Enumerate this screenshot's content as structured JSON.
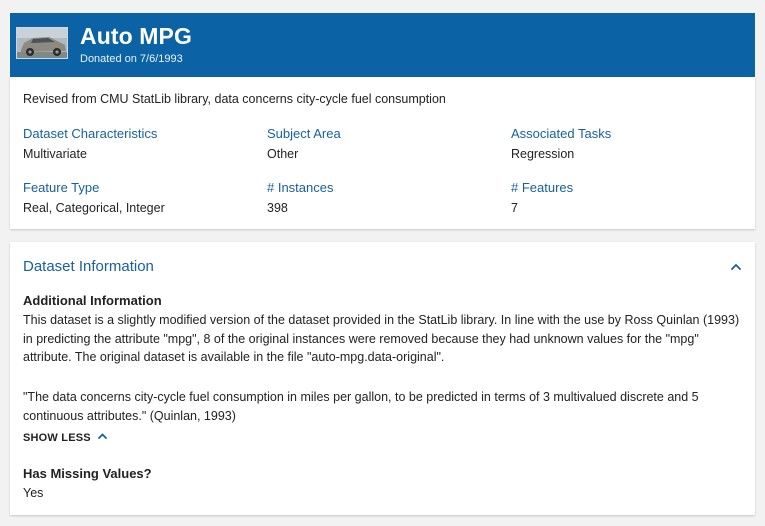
{
  "header": {
    "title": "Auto MPG",
    "donated": "Donated on 7/6/1993",
    "thumbnail_icon": "car-photo-icon"
  },
  "summary": {
    "description": "Revised from CMU StatLib library, data concerns city-cycle fuel consumption",
    "attributes": [
      {
        "label": "Dataset Characteristics",
        "value": "Multivariate"
      },
      {
        "label": "Subject Area",
        "value": "Other"
      },
      {
        "label": "Associated Tasks",
        "value": "Regression"
      },
      {
        "label": "Feature Type",
        "value": "Real, Categorical, Integer"
      },
      {
        "label": "# Instances",
        "value": "398"
      },
      {
        "label": "# Features",
        "value": "7"
      }
    ]
  },
  "info": {
    "title": "Dataset Information",
    "collapse_icon": "chevron-up-icon",
    "additional_heading": "Additional Information",
    "paragraph1": "This dataset is a slightly modified version of the dataset provided in the StatLib library.  In line with the use by Ross Quinlan (1993) in predicting the attribute \"mpg\", 8 of the original instances were removed because they had unknown values for the \"mpg\" attribute.  The original dataset is available in the file \"auto-mpg.data-original\".",
    "paragraph2": "\"The data concerns city-cycle fuel consumption in miles per gallon, to be predicted in terms of 3 multivalued discrete and 5 continuous attributes.\" (Quinlan, 1993)",
    "show_less": "SHOW LESS",
    "missing_heading": "Has Missing Values?",
    "missing_value": "Yes"
  },
  "colors": {
    "header_bg": "#0b63a5",
    "link_blue": "#17619e",
    "page_bg": "#f2f2f2"
  }
}
